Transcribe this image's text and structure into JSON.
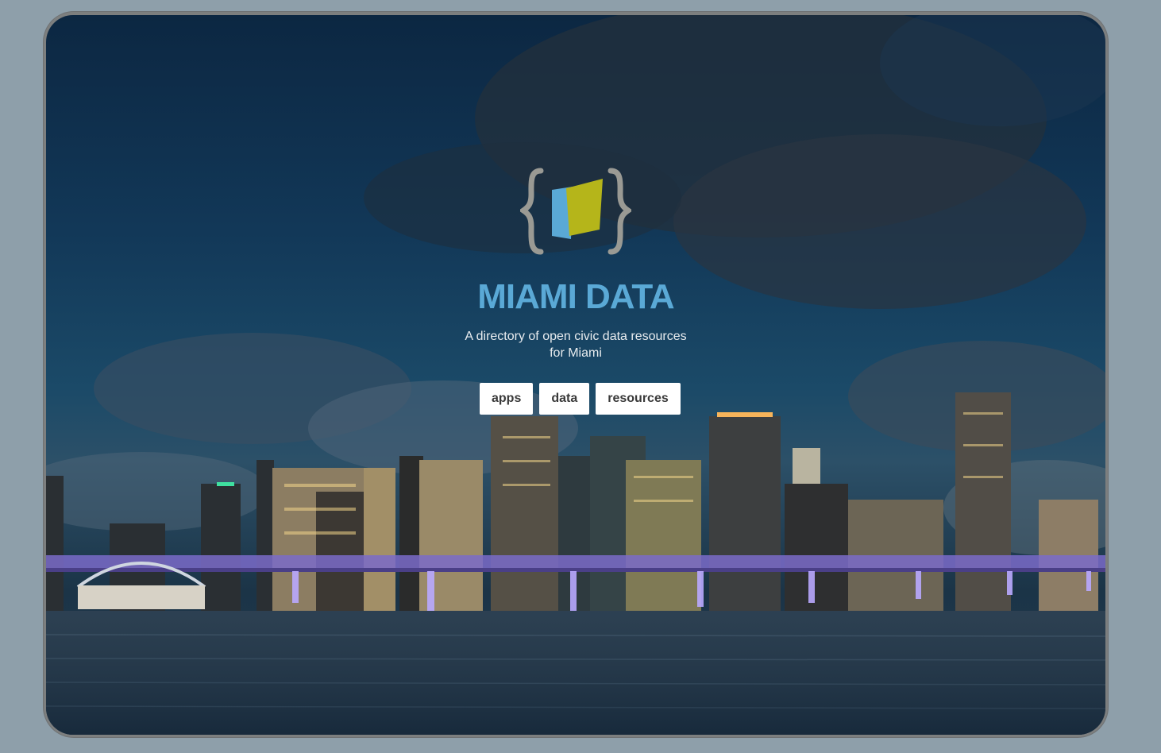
{
  "site": {
    "title": "MIAMI DATA",
    "subtitle": "A directory of open civic data resources for Miami",
    "logo": "miami-data-logo"
  },
  "nav": {
    "items": [
      {
        "label": "apps"
      },
      {
        "label": "data"
      },
      {
        "label": "resources"
      }
    ]
  },
  "colors": {
    "title": "#5aa9d6",
    "logo_blue": "#5aa9d6",
    "logo_green": "#b5b51a",
    "logo_brace": "#9a9a94",
    "page_bg": "#8e9faa"
  },
  "background": {
    "description_icon": "miami-skyline-night-photo"
  }
}
